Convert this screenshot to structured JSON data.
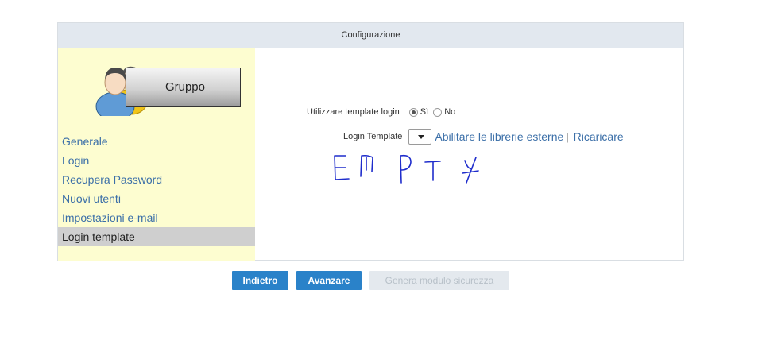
{
  "panel": {
    "title": "Configurazione"
  },
  "sidebar": {
    "group_label": "Gruppo",
    "menu": [
      {
        "label": "Generale",
        "active": false
      },
      {
        "label": "Login",
        "active": false
      },
      {
        "label": "Recupera Password",
        "active": false
      },
      {
        "label": "Nuovi utenti",
        "active": false
      },
      {
        "label": "Impostazioni e-mail",
        "active": false
      },
      {
        "label": "Login template",
        "active": true
      }
    ]
  },
  "form": {
    "use_template_label": "Utilizzare template login",
    "option_yes": "Sì",
    "option_no": "No",
    "selected_option": "Sì",
    "login_template_label": "Login Template",
    "select_value": "",
    "link_external": "Abilitare le librerie esterne",
    "separator": "|",
    "link_reload": "Ricaricare",
    "handwritten_note": "EMPty"
  },
  "buttons": {
    "back": "Indietro",
    "next": "Avanzare",
    "generate": "Genera modulo sicurezza"
  },
  "colors": {
    "accent": "#2a82c9",
    "link": "#3b6fa8",
    "sidebar_bg": "#fdfdd0",
    "header_bg": "#e2e8ef"
  }
}
